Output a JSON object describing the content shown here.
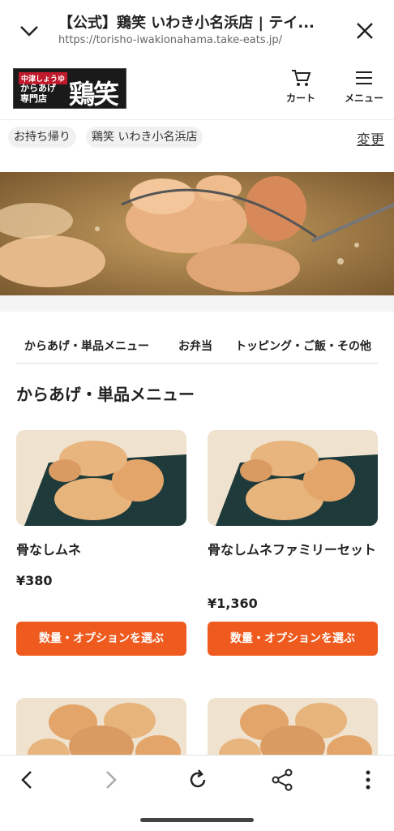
{
  "browser": {
    "title": "【公式】鶏笑 いわき小名浜店 | テイ...",
    "url": "https://torisho-iwakionahama.take-eats.jp/"
  },
  "header": {
    "logo_tag": "中津しょうゆ",
    "logo_sub": "からあげ 専門店",
    "logo_brand": "鶏笑",
    "cart_label": "カート",
    "menu_label": "メニュー"
  },
  "store": {
    "mode": "お持ち帰り",
    "name": "鶏笑 いわき小名浜店",
    "change_label": "変更"
  },
  "tabs": [
    "からあげ・単品メニュー",
    "お弁当",
    "トッピング・ご飯・その他"
  ],
  "section_title": "からあげ・単品メニュー",
  "products": [
    {
      "name": "骨なしムネ",
      "price": "¥380",
      "button": "数量・オプションを選ぶ"
    },
    {
      "name": "骨なしムネファミリーセット",
      "price": "¥1,360",
      "button": "数量・オプションを選ぶ"
    }
  ],
  "colors": {
    "accent": "#ef5a1e",
    "logo_bg": "#1a1a1a",
    "logo_red": "#c0192c"
  },
  "icons": [
    "chevron-down-icon",
    "close-icon",
    "cart-icon",
    "hamburger-menu-icon",
    "back-arrow-icon",
    "forward-arrow-icon",
    "reload-icon",
    "share-icon",
    "more-vert-icon"
  ]
}
